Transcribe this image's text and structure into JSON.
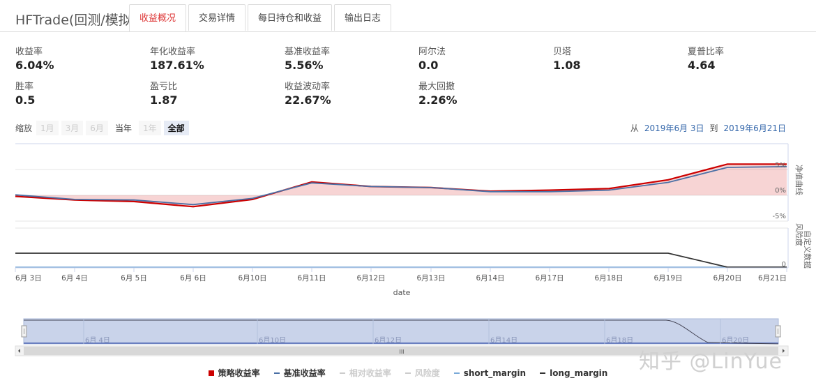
{
  "app": {
    "title": "HFTrade(回测/模拟)"
  },
  "tabs": [
    {
      "label": "收益概况",
      "active": true
    },
    {
      "label": "交易详情",
      "active": false
    },
    {
      "label": "每日持仓和收益",
      "active": false
    },
    {
      "label": "输出日志",
      "active": false
    }
  ],
  "metrics": [
    {
      "label": "收益率",
      "value": "6.04%"
    },
    {
      "label": "年化收益率",
      "value": "187.61%"
    },
    {
      "label": "基准收益率",
      "value": "5.56%"
    },
    {
      "label": "阿尔法",
      "value": "0.0"
    },
    {
      "label": "贝塔",
      "value": "1.08"
    },
    {
      "label": "夏普比率",
      "value": "4.64"
    },
    {
      "label": "胜率",
      "value": "0.5"
    },
    {
      "label": "盈亏比",
      "value": "1.87"
    },
    {
      "label": "收益波动率",
      "value": "22.67%"
    },
    {
      "label": "最大回撤",
      "value": "2.26%"
    }
  ],
  "zoom": {
    "label": "缩放",
    "buttons": [
      {
        "label": "1月",
        "state": "disabled"
      },
      {
        "label": "3月",
        "state": "disabled"
      },
      {
        "label": "6月",
        "state": "disabled"
      },
      {
        "label": "当年",
        "state": "enabled"
      },
      {
        "label": "1年",
        "state": "disabled"
      },
      {
        "label": "全部",
        "state": "selected"
      }
    ]
  },
  "range": {
    "from_label": "从",
    "from": "2019年6月 3日",
    "to_label": "到",
    "to": "2019年6月21日"
  },
  "chart_data": {
    "type": "line",
    "x": [
      "6月 3日",
      "6月 4日",
      "6月 5日",
      "6月 6日",
      "6月10日",
      "6月11日",
      "6月12日",
      "6月13日",
      "6月14日",
      "6月17日",
      "6月18日",
      "6月19日",
      "6月20日",
      "6月21日"
    ],
    "xlabel": "date",
    "panels": [
      {
        "name": "净值曲线",
        "yticks": [
          "5%",
          "0%",
          "-5%"
        ],
        "ylim": [
          -5,
          6
        ],
        "series": [
          {
            "name": "策略收益率",
            "color": "#cc0000",
            "values": [
              -0.2,
              -0.9,
              -1.2,
              -2.2,
              -0.8,
              2.6,
              1.7,
              1.5,
              0.8,
              1.0,
              1.3,
              3.0,
              6.04,
              6.04
            ]
          },
          {
            "name": "基准收益率",
            "color": "#4a6fa5",
            "values": [
              0.1,
              -0.8,
              -0.9,
              -1.8,
              -0.6,
              2.4,
              1.7,
              1.5,
              0.7,
              0.7,
              1.0,
              2.5,
              5.4,
              5.56
            ]
          }
        ]
      },
      {
        "name": "风险度",
        "alt_name": "自定义数据",
        "yticks": [
          "0"
        ],
        "series": [
          {
            "name": "long_margin",
            "color": "#333333",
            "values": [
              1,
              1,
              1,
              1,
              1,
              1,
              1,
              1,
              1,
              1,
              1,
              1,
              0,
              0
            ]
          },
          {
            "name": "short_margin",
            "color": "#7aaad8",
            "values": [
              0,
              0,
              0,
              0,
              0,
              0,
              0,
              0,
              0,
              0,
              0,
              0,
              0,
              0
            ]
          }
        ]
      }
    ],
    "navigator_labels": [
      "6月 4日",
      "6月10日",
      "6月12日",
      "6月14日",
      "6月18日",
      "6月20日"
    ],
    "legend": [
      {
        "name": "策略收益率",
        "color": "#cc0000",
        "symbol": "square",
        "visible": true
      },
      {
        "name": "基准收益率",
        "color": "#4a6fa5",
        "symbol": "dash",
        "visible": true
      },
      {
        "name": "相对收益率",
        "color": "#cccccc",
        "symbol": "dash",
        "visible": false
      },
      {
        "name": "风险度",
        "color": "#cccccc",
        "symbol": "dash",
        "visible": false
      },
      {
        "name": "short_margin",
        "color": "#7aaad8",
        "symbol": "dash",
        "visible": true
      },
      {
        "name": "long_margin",
        "color": "#333333",
        "symbol": "dash",
        "visible": true
      }
    ]
  },
  "navigator": {
    "handle_label": "III"
  },
  "watermark": "知乎 @LinYue"
}
